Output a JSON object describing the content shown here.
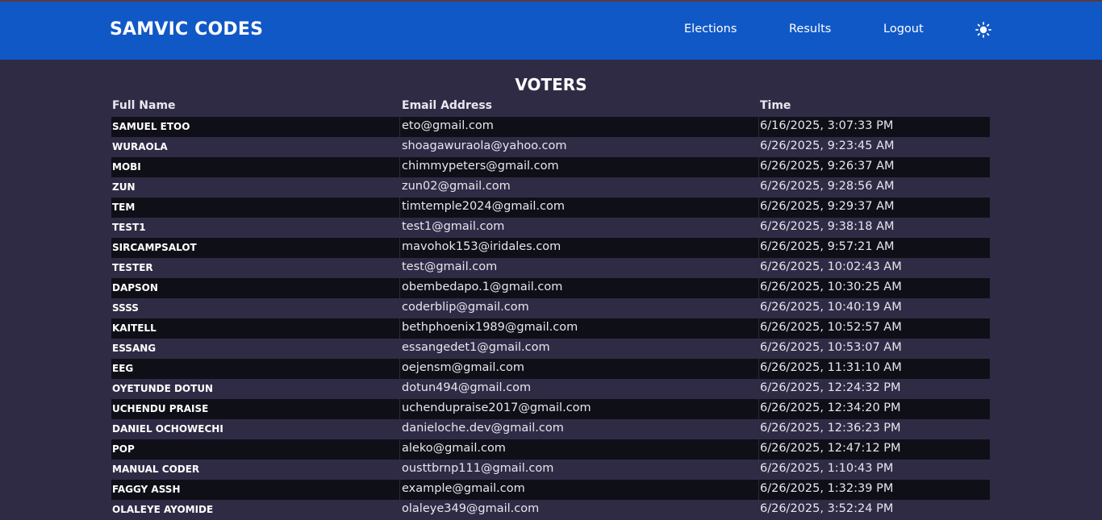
{
  "header": {
    "brand": "SAMVIC CODES",
    "nav": [
      "Elections",
      "Results",
      "Logout"
    ],
    "theme_icon": "sun-icon"
  },
  "page_title": "VOTERS",
  "table": {
    "columns": [
      "Full Name",
      "Email Address",
      "Time"
    ],
    "rows": [
      {
        "name": "SAMUEL ETOO",
        "email": "eto@gmail.com",
        "time": "6/16/2025, 3:07:33 PM"
      },
      {
        "name": "WURAOLA",
        "email": "shoagawuraola@yahoo.com",
        "time": "6/26/2025, 9:23:45 AM"
      },
      {
        "name": "MOBI",
        "email": "chimmypeters@gmail.com",
        "time": "6/26/2025, 9:26:37 AM"
      },
      {
        "name": "ZUN",
        "email": "zun02@gmail.com",
        "time": "6/26/2025, 9:28:56 AM"
      },
      {
        "name": "TEM",
        "email": "timtemple2024@gmail.com",
        "time": "6/26/2025, 9:29:37 AM"
      },
      {
        "name": "TEST1",
        "email": "test1@gmail.com",
        "time": "6/26/2025, 9:38:18 AM"
      },
      {
        "name": "SIRCAMPSALOT",
        "email": "mavohok153@iridales.com",
        "time": "6/26/2025, 9:57:21 AM"
      },
      {
        "name": "TESTER",
        "email": "test@gmail.com",
        "time": "6/26/2025, 10:02:43 AM"
      },
      {
        "name": "DAPSON",
        "email": "obembedapo.1@gmail.com",
        "time": "6/26/2025, 10:30:25 AM"
      },
      {
        "name": "SSSS",
        "email": "coderblip@gmail.com",
        "time": "6/26/2025, 10:40:19 AM"
      },
      {
        "name": "KAITELL",
        "email": "bethphoenix1989@gmail.com",
        "time": "6/26/2025, 10:52:57 AM"
      },
      {
        "name": "ESSANG",
        "email": "essangedet1@gmail.com",
        "time": "6/26/2025, 10:53:07 AM"
      },
      {
        "name": "EEG",
        "email": "oejensm@gmail.com",
        "time": "6/26/2025, 11:31:10 AM"
      },
      {
        "name": "OYETUNDE DOTUN",
        "email": "dotun494@gmail.com",
        "time": "6/26/2025, 12:24:32 PM"
      },
      {
        "name": "UCHENDU PRAISE",
        "email": "uchendupraise2017@gmail.com",
        "time": "6/26/2025, 12:34:20 PM"
      },
      {
        "name": "DANIEL OCHOWECHI",
        "email": "danieloche.dev@gmail.com",
        "time": "6/26/2025, 12:36:23 PM"
      },
      {
        "name": "POP",
        "email": "aleko@gmail.com",
        "time": "6/26/2025, 12:47:12 PM"
      },
      {
        "name": "MANUAL CODER",
        "email": "ousttbrnp111@gmail.com",
        "time": "6/26/2025, 1:10:43 PM"
      },
      {
        "name": "FAGGY ASSH",
        "email": "example@gmail.com",
        "time": "6/26/2025, 1:32:39 PM"
      },
      {
        "name": "OLALEYE AYOMIDE",
        "email": "olaleye349@gmail.com",
        "time": "6/26/2025, 3:52:24 PM"
      }
    ]
  },
  "colors": {
    "navbar": "#1158c7",
    "background": "#302b45",
    "row_dark": "#0f0f17"
  }
}
